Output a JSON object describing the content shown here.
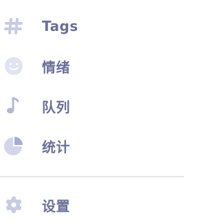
{
  "menu": {
    "items": [
      {
        "label": "Tags",
        "icon": "hash-icon"
      },
      {
        "label": "情绪",
        "icon": "smiley-icon"
      },
      {
        "label": "队列",
        "icon": "music-note-icon"
      },
      {
        "label": "统计",
        "icon": "pie-chart-icon"
      }
    ],
    "settings": {
      "label": "设置",
      "icon": "gear-icon"
    }
  },
  "colors": {
    "label": "#6b6f99",
    "icon": "#c9cbe3",
    "icon_accent": "#a9acd0",
    "divider": "#e4e6f2"
  }
}
